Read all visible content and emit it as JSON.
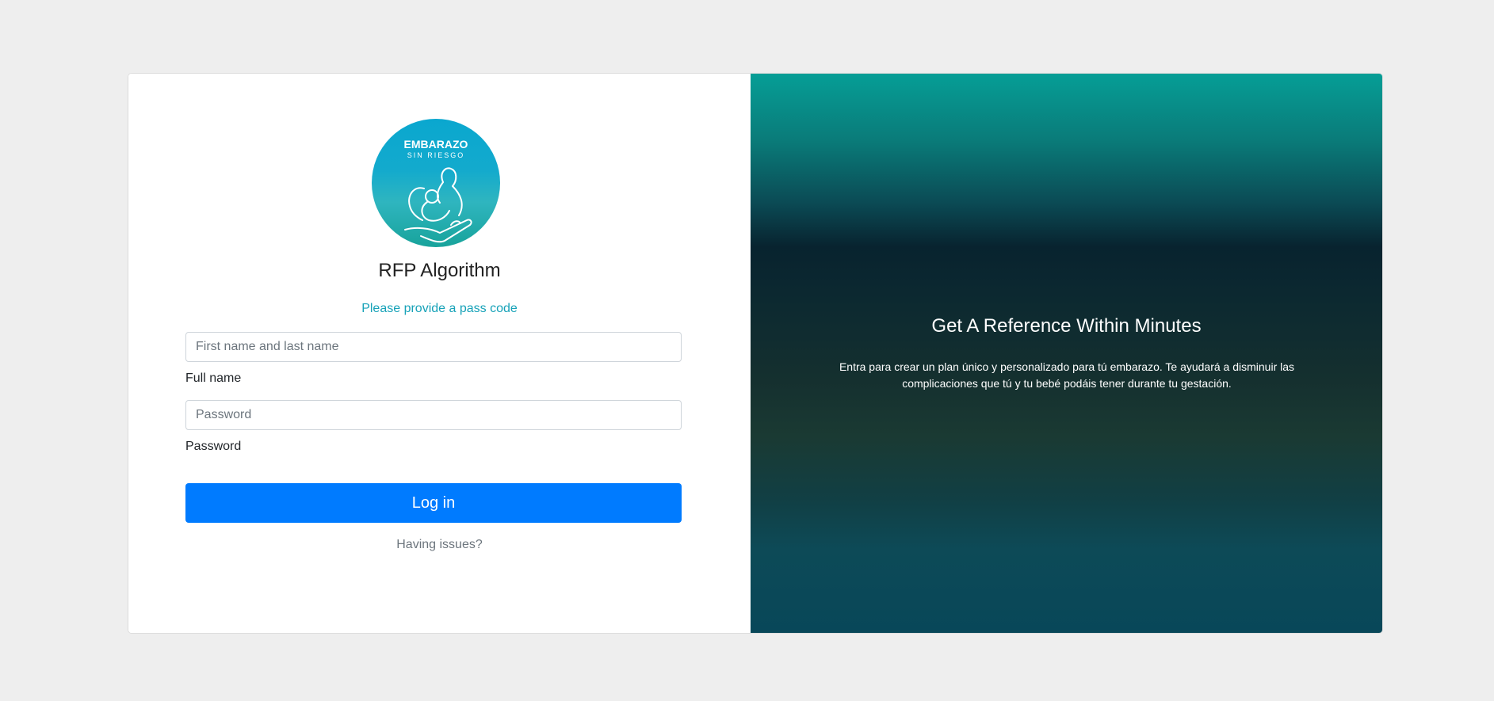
{
  "brand": {
    "logo_line1": "EMBARAZO",
    "logo_line2": "SIN RIESGO",
    "logo_icon": "mother-child-hand-icon",
    "accent_color": "#17a2b8"
  },
  "login": {
    "title": "RFP Algorithm",
    "subtitle": "Please provide a pass code",
    "fullname_placeholder": "First name and last name",
    "fullname_value": "",
    "fullname_label": "Full name",
    "password_placeholder": "Password",
    "password_value": "",
    "password_label": "Password",
    "login_button": "Log in",
    "login_button_color": "#007bff",
    "issues_link": "Having issues?"
  },
  "promo": {
    "title": "Get A Reference Within Minutes",
    "text": "Entra para crear un plan único y personalizado para tú embarazo. Te ayudará a disminuir las complicaciones que tú y tu bebé podáis tener durante tu gestación."
  }
}
